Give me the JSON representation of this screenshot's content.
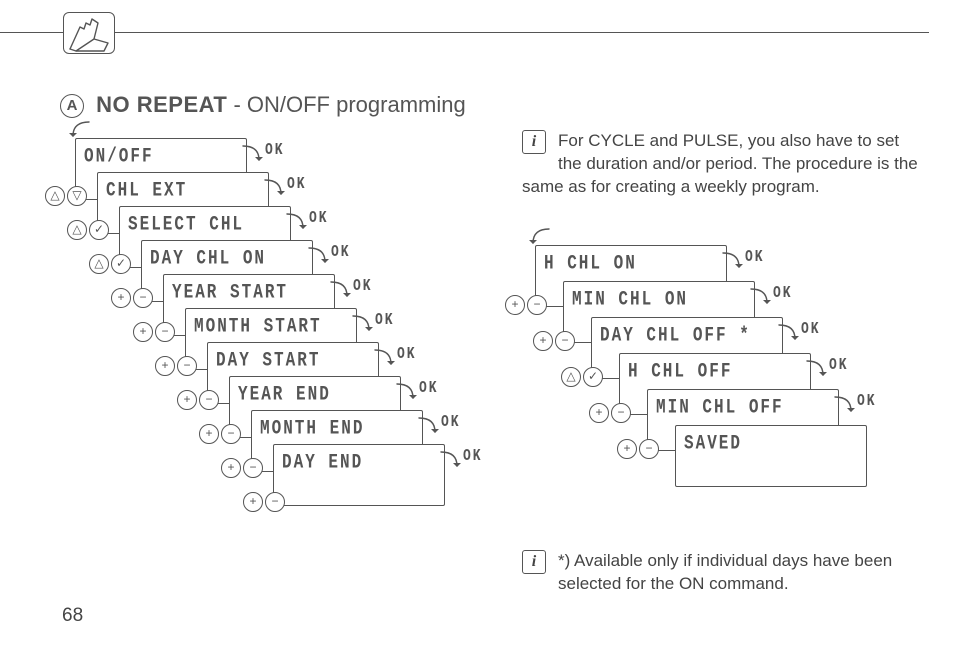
{
  "page_number": "68",
  "header_icon": "hand-swipe-icon",
  "heading": {
    "letter": "A",
    "bold": "NO REPEAT",
    "rest": " - ON/OFF programming"
  },
  "ok_label": "OK",
  "info1": "For CYCLE and PULSE, you also have to set the duration and/or period. The procedure is the same as for creating a weekly program.",
  "info2": "*) Available only if individual days have been selected for the ON command.",
  "left_stack": [
    {
      "label": "ON/OFF",
      "ctrl": "updown"
    },
    {
      "label": "CHL EXT",
      "ctrl": "upcheck"
    },
    {
      "label": "SELECT CHL",
      "ctrl": "upcheck"
    },
    {
      "label": "DAY CHL ON",
      "ctrl": "plusminus"
    },
    {
      "label": "YEAR START",
      "ctrl": "plusminus"
    },
    {
      "label": "MONTH START",
      "ctrl": "plusminus"
    },
    {
      "label": "DAY START",
      "ctrl": "plusminus"
    },
    {
      "label": "YEAR END",
      "ctrl": "plusminus"
    },
    {
      "label": "MONTH END",
      "ctrl": "plusminus"
    },
    {
      "label": "DAY END",
      "ctrl": "plusminus"
    }
  ],
  "right_stack": [
    {
      "label": "H CHL ON",
      "ctrl": "plusminus"
    },
    {
      "label": "MIN CHL ON",
      "ctrl": "plusminus"
    },
    {
      "label": "DAY CHL OFF *",
      "ctrl": "upcheck"
    },
    {
      "label": "H CHL OFF",
      "ctrl": "plusminus"
    },
    {
      "label": "MIN CHL OFF",
      "ctrl": "plusminus"
    },
    {
      "label": "SAVED",
      "ctrl": "none"
    }
  ],
  "ctrl_glyphs": {
    "up": "△",
    "down": "▽",
    "plus": "+",
    "minus": "−",
    "check": "✓"
  }
}
